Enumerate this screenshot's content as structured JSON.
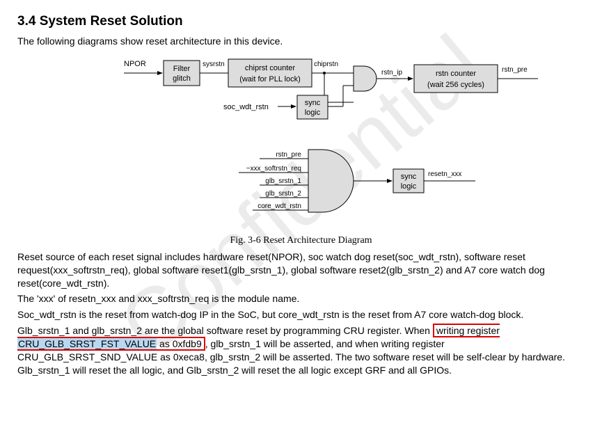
{
  "heading": "3.4 System Reset Solution",
  "intro": "The following diagrams show reset architecture in this device.",
  "watermark": "Confidential",
  "diagram": {
    "labels": {
      "npor": "NPOR",
      "filter_glitch": "Filter glitch",
      "sysrstn": "sysrstn",
      "chiprst_counter_l1": "chiprst counter",
      "chiprst_counter_l2": "(wait for PLL lock)",
      "chiprstn": "chiprstn",
      "rstn_ip": "rstn_ip",
      "rstn_counter_l1": "rstn counter",
      "rstn_counter_l2": "(wait 256 cycles)",
      "rstn_pre_out": "rstn_pre",
      "soc_wdt_rstn": "soc_wdt_rstn",
      "sync_logic": "sync logic",
      "rstn_pre_in": "rstn_pre",
      "softrstn_req": "~xxx_softrstn_req",
      "glb_srstn_1": "glb_srstn_1",
      "glb_srstn_2": "glb_srstn_2",
      "core_wdt_rstn": "core_wdt_rstn",
      "resetn_xxx": "resetn_xxx"
    },
    "caption": "Fig. 3-6 Reset Architecture Diagram"
  },
  "body1": "Reset source of each reset signal includes hardware reset(NPOR), soc watch dog reset(soc_wdt_rstn), software reset request(xxx_softrstn_req), global software reset1(glb_srstn_1), global software reset2(glb_srstn_2) and A7 core watch dog reset(core_wdt_rstn).",
  "body2": "The 'xxx' of resetn_xxx and xxx_softrstn_req is the module name.",
  "body3": "Soc_wdt_rstn is the reset from watch-dog IP in the SoC, but core_wdt_rstn is the reset from A7 core watch-dog block.",
  "body4_a": "Glb_srstn_1 and glb_srstn_2 are the global software reset by programming CRU register. When ",
  "body4_hl_pre": "writing register ",
  "body4_hl_reg": "CRU_GLB_SRST_FST_VALUE",
  "body4_hl_post": " as 0xfdb9",
  "body4_b": ", glb_srstn_1 will be asserted, and when writing register CRU_GLB_SRST_SND_VALUE as 0xeca8, glb_srstn_2 will be asserted. The two software reset will be self-clear by hardware. Glb_srstn_1 will reset the all logic, and Glb_srstn_2 will reset the all logic except GRF and all GPIOs."
}
